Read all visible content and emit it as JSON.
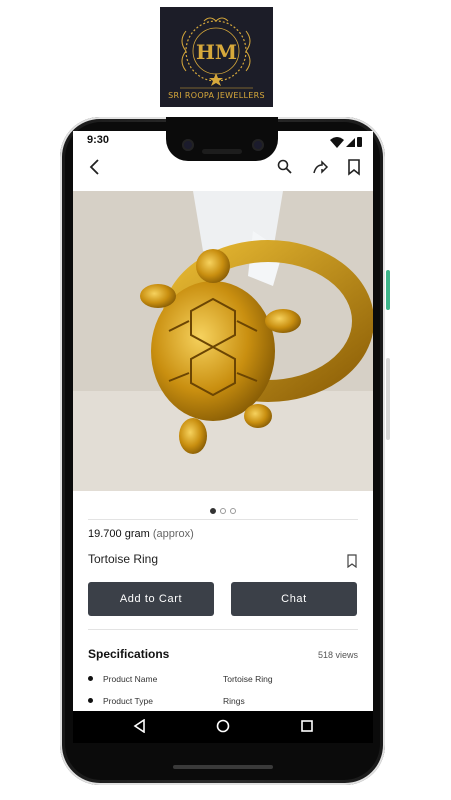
{
  "brand": {
    "logo_text": "SRI ROOPA JEWELLERS",
    "logo_monogram": "HM",
    "logo_color": "#d7a93b",
    "logo_bg": "#1c1d28"
  },
  "status_bar": {
    "time": "9:30"
  },
  "app_bar": {
    "icons": [
      "back-arrow-icon",
      "search-icon",
      "share-icon",
      "bookmark-icon"
    ]
  },
  "gallery": {
    "image_subject": "gold tortoise ring",
    "total": 3,
    "active": 1
  },
  "product": {
    "weight": "19.700 gram",
    "weight_note": "(approx)",
    "name": "Tortoise Ring"
  },
  "actions": {
    "add_to_cart": "Add to Cart",
    "chat": "Chat"
  },
  "specifications": {
    "title": "Specifications",
    "views": "518 views",
    "rows": [
      {
        "label": "Product Name",
        "value": "Tortoise Ring"
      },
      {
        "label": "Product Type",
        "value": "Rings"
      }
    ]
  },
  "colors": {
    "button_bg": "#3b4048",
    "accent_side_button": "#3fb68b"
  }
}
